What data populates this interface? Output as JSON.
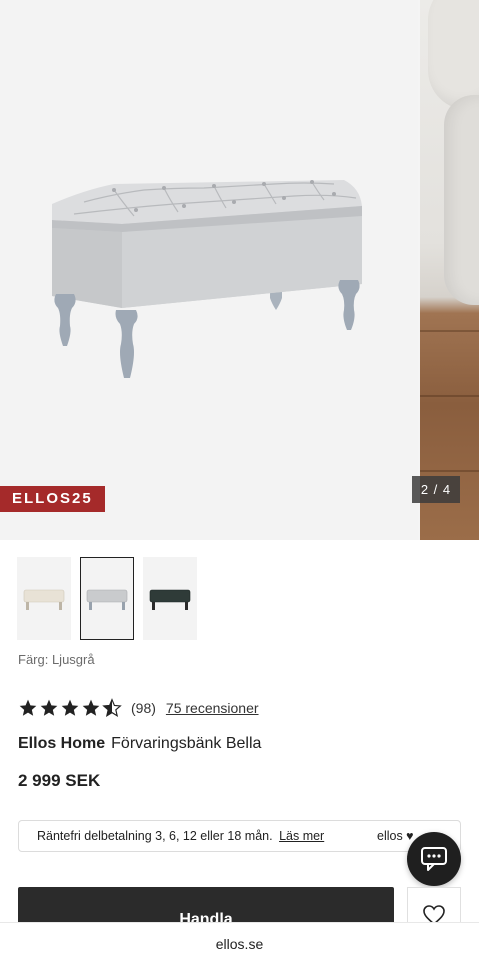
{
  "gallery": {
    "promo_badge": "ELLOS25",
    "counter": "2 / 4",
    "current_image": 2,
    "total_images": 4
  },
  "thumbnails": [
    {
      "name": "beige",
      "color": "#e8e2d6",
      "selected": false
    },
    {
      "name": "light-grey",
      "color": "#c9cbcd",
      "selected": true
    },
    {
      "name": "dark-green",
      "color": "#2f3b38",
      "selected": false
    }
  ],
  "color_label": "Färg: Ljusgrå",
  "rating": {
    "value": 4.5,
    "max": 5,
    "count_text": "(98)",
    "reviews_link": "75 recensioner"
  },
  "product": {
    "brand": "Ellos Home",
    "name": "Förvaringsbänk Bella",
    "price": "2 999 SEK"
  },
  "installment": {
    "text": "Räntefri delbetalning 3, 6, 12 eller 18 mån.",
    "link": "Läs mer",
    "logo": "ellos ♥"
  },
  "actions": {
    "buy_label": "Handla"
  },
  "browser": {
    "url": "ellos.se"
  },
  "colors": {
    "promo": "#a52a2a",
    "button": "#2b2b2b",
    "chat": "#1f1f1f"
  }
}
